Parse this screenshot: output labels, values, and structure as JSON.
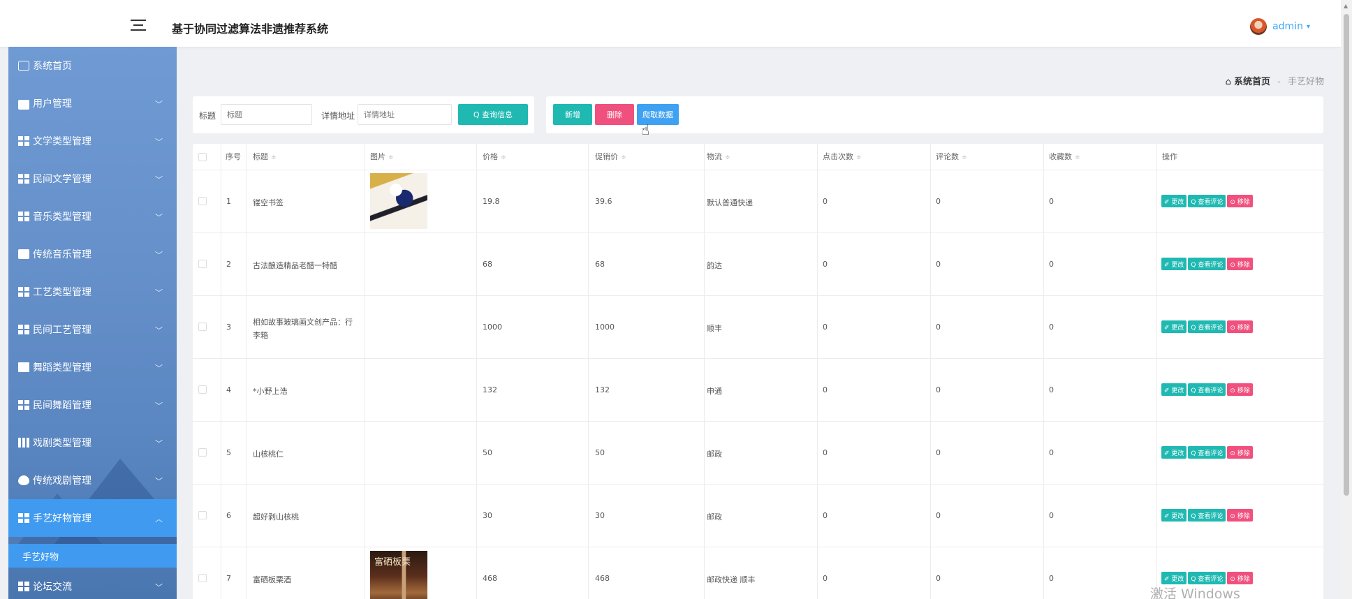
{
  "header": {
    "title": "基于协同过滤算法非遗推荐系统",
    "user_name": "admin",
    "caret": "▾"
  },
  "sidebar": {
    "items": [
      {
        "label": "系统首页",
        "icon": "home-icon"
      },
      {
        "label": "用户管理",
        "icon": "user-icon"
      },
      {
        "label": "文学类型管理",
        "icon": "grid-icon"
      },
      {
        "label": "民间文学管理",
        "icon": "grid-icon"
      },
      {
        "label": "音乐类型管理",
        "icon": "grid-icon"
      },
      {
        "label": "传统音乐管理",
        "icon": "clipboard-icon"
      },
      {
        "label": "工艺类型管理",
        "icon": "grid-icon"
      },
      {
        "label": "民间工艺管理",
        "icon": "grid-icon"
      },
      {
        "label": "舞蹈类型管理",
        "icon": "screen-icon"
      },
      {
        "label": "民间舞蹈管理",
        "icon": "grid-icon"
      },
      {
        "label": "戏剧类型管理",
        "icon": "bar-chart-icon"
      },
      {
        "label": "传统戏剧管理",
        "icon": "pin-icon"
      },
      {
        "label": "手艺好物管理",
        "icon": "grid-icon"
      },
      {
        "label": "论坛交流",
        "icon": "grid-icon"
      }
    ],
    "sub_item": "手艺好物",
    "chevron_down": "﹀",
    "chevron_up": "︿"
  },
  "breadcrumb": {
    "home_icon": "⌂",
    "home": "系统首页",
    "separator": "-",
    "current": "手艺好物"
  },
  "search": {
    "title_label": "标题",
    "title_placeholder": "标题",
    "url_label": "详情地址",
    "url_placeholder": "详情地址",
    "query_button": "Q 查询信息"
  },
  "actions": {
    "add": "新增",
    "delete": "删除",
    "crawl": "爬取数据"
  },
  "table": {
    "headers": [
      "序号",
      "标题",
      "图片",
      "价格",
      "促销价",
      "物流",
      "点击次数",
      "评论数",
      "收藏数",
      "操作"
    ],
    "sort_icon": "≑",
    "rows": [
      {
        "idx": "1",
        "title": "镂空书签",
        "price": "19.8",
        "promo": "39.6",
        "logistics": "默认普通快递",
        "clicks": "0",
        "comments": "0",
        "favs": "0"
      },
      {
        "idx": "2",
        "title": "古法酿造精品老醋一特醋",
        "price": "68",
        "promo": "68",
        "logistics": "韵达",
        "clicks": "0",
        "comments": "0",
        "favs": "0"
      },
      {
        "idx": "3",
        "title": "相如故事玻璃画文创产品：行李箱",
        "price": "1000",
        "promo": "1000",
        "logistics": "顺丰",
        "clicks": "0",
        "comments": "0",
        "favs": "0"
      },
      {
        "idx": "4",
        "title": "*小野上浩",
        "price": "132",
        "promo": "132",
        "logistics": "申通",
        "clicks": "0",
        "comments": "0",
        "favs": "0"
      },
      {
        "idx": "5",
        "title": "山核桃仁",
        "price": "50",
        "promo": "50",
        "logistics": "邮政",
        "clicks": "0",
        "comments": "0",
        "favs": "0"
      },
      {
        "idx": "6",
        "title": "超好剥山核桃",
        "price": "30",
        "promo": "30",
        "logistics": "邮政",
        "clicks": "0",
        "comments": "0",
        "favs": "0"
      },
      {
        "idx": "7",
        "title": "富硒板栗酒",
        "price": "468",
        "promo": "468",
        "logistics": "邮政快递 顺丰",
        "clicks": "0",
        "comments": "0",
        "favs": "0"
      }
    ],
    "ops": {
      "edit": "✐ 更改",
      "view": "Q 查看评论",
      "del": "⊙ 移除"
    },
    "thumb7_text": "富硒板栗"
  },
  "watermark": "激活 Windows"
}
